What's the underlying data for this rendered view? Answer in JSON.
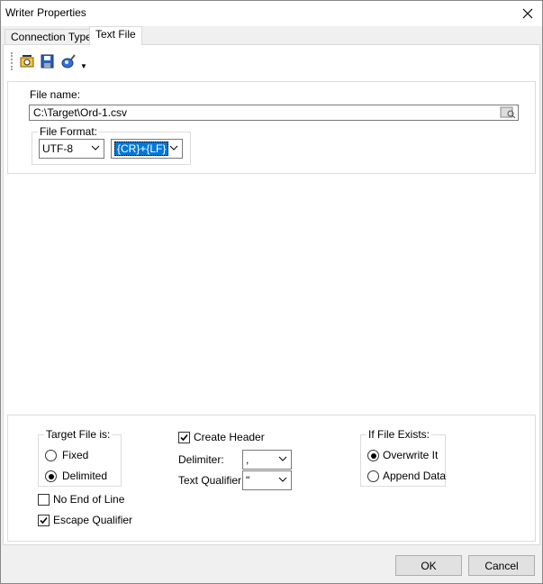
{
  "window": {
    "title": "Writer Properties",
    "close_icon": "close-icon"
  },
  "tabs": [
    {
      "label": "Connection Type"
    },
    {
      "label": "Text File"
    }
  ],
  "toolbar": {
    "icons": [
      "settings-icon",
      "save-icon",
      "clear-icon"
    ],
    "dropdown_icon": "dropdown-arrow-icon"
  },
  "file": {
    "name_label": "File name:",
    "name_value": "C:\\Target\\Ord-1.csv",
    "browse_icon": "browse-icon",
    "format_label": "File Format:",
    "encoding": "UTF-8",
    "line_ending": "{CR}+{LF}"
  },
  "target": {
    "legend": "Target File is:",
    "options": [
      {
        "label": "Fixed",
        "checked": false
      },
      {
        "label": "Delimited",
        "checked": true
      }
    ]
  },
  "no_end_of_line": {
    "label": "No End of Line",
    "checked": false
  },
  "escape_qualifier": {
    "label": "Escape Qualifier",
    "checked": true
  },
  "create_header": {
    "label": "Create Header",
    "checked": true
  },
  "delimiter": {
    "label": "Delimiter:",
    "value": ","
  },
  "text_qualifier": {
    "label": "Text Qualifier:",
    "value": "\""
  },
  "if_exists": {
    "legend": "If File Exists:",
    "options": [
      {
        "label": "Overwrite It",
        "checked": true
      },
      {
        "label": "Append Data",
        "checked": false
      }
    ]
  },
  "buttons": {
    "ok": "OK",
    "cancel": "Cancel"
  }
}
